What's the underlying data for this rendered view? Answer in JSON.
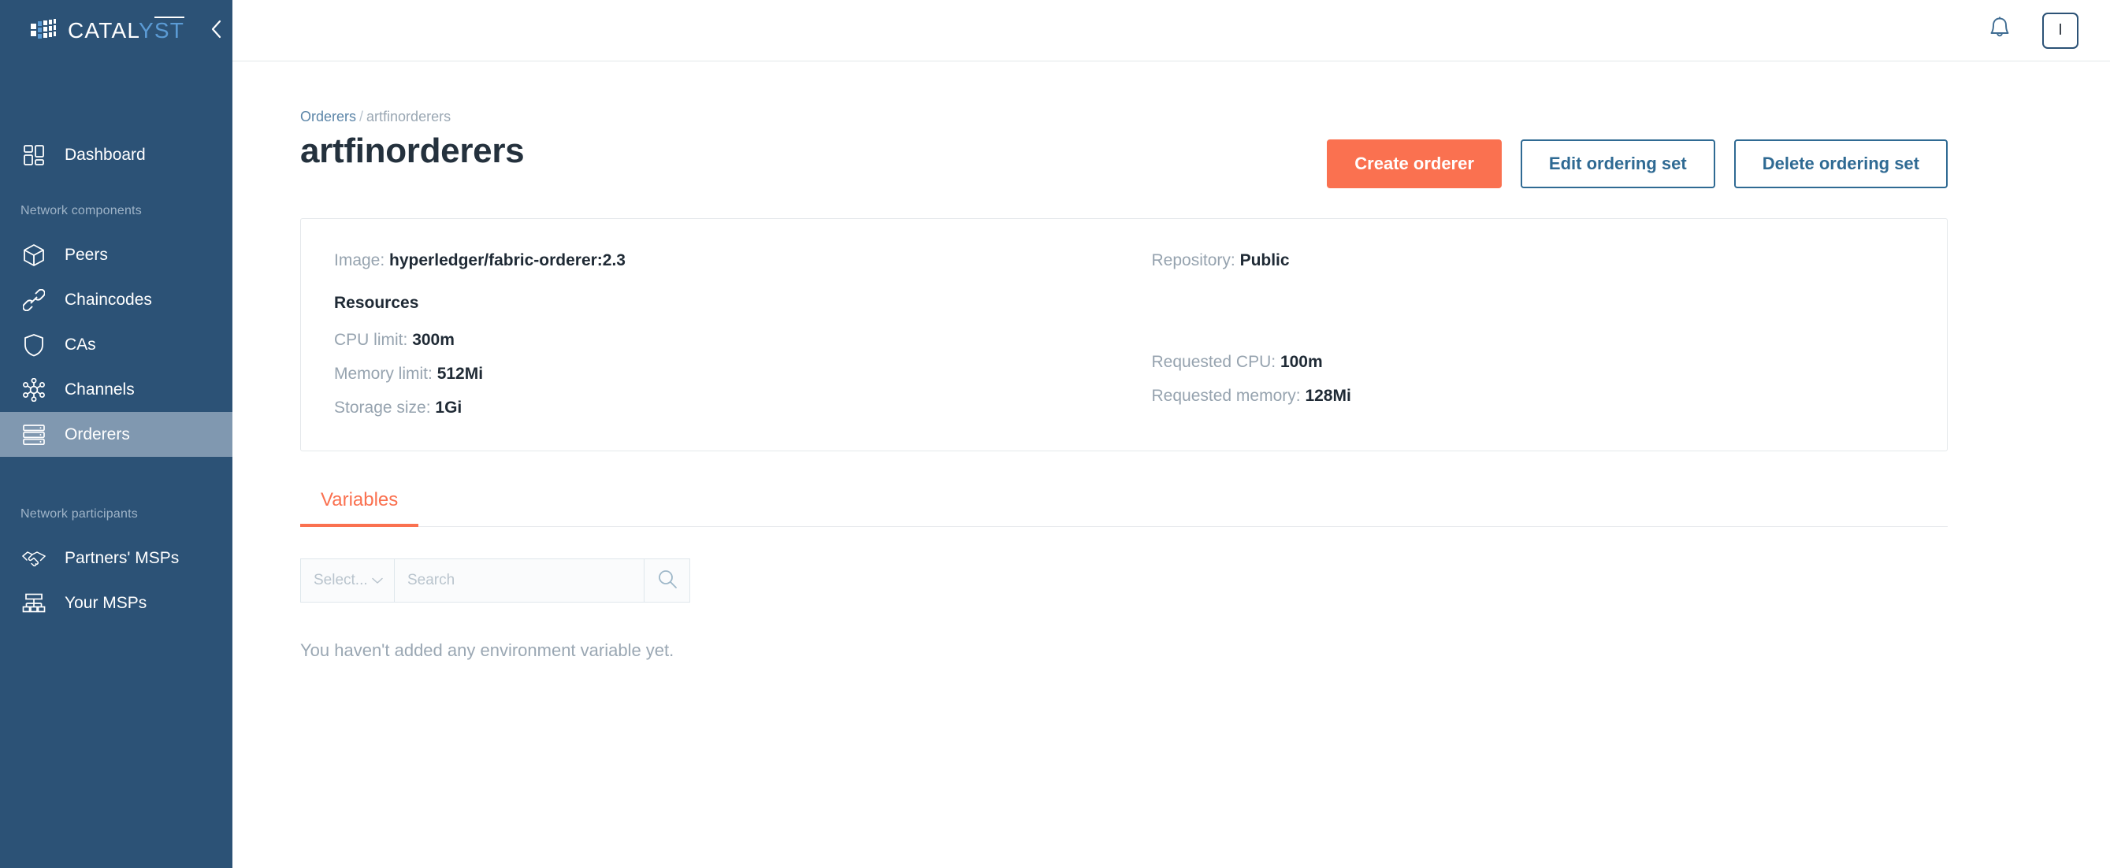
{
  "sidebar": {
    "brand": {
      "text_dark": "CATAL",
      "text_accent": "Y",
      "text_bar": "ST",
      "logo_icon": "cube-grid-icon"
    },
    "collapse_icon": "chevron-left-icon",
    "primary_items": [
      {
        "label": "Dashboard",
        "icon": "grid-dashboard-icon",
        "active": false
      }
    ],
    "section_components_label": "Network components",
    "component_items": [
      {
        "label": "Peers",
        "icon": "cube-icon",
        "active": false
      },
      {
        "label": "Chaincodes",
        "icon": "link-chain-icon",
        "active": false
      },
      {
        "label": "CAs",
        "icon": "shield-icon",
        "active": false
      },
      {
        "label": "Channels",
        "icon": "network-hub-icon",
        "active": false
      },
      {
        "label": "Orderers",
        "icon": "server-stack-icon",
        "active": true
      }
    ],
    "section_participants_label": "Network participants",
    "participant_items": [
      {
        "label": "Partners' MSPs",
        "icon": "handshake-icon",
        "active": false
      },
      {
        "label": "Your MSPs",
        "icon": "org-chart-icon",
        "active": false
      }
    ]
  },
  "topbar": {
    "bell_icon": "bell-icon",
    "avatar_label": "I"
  },
  "breadcrumb": {
    "parent": "Orderers",
    "separator": "/",
    "current": "artfinorderers"
  },
  "page": {
    "title": "artfinorderers"
  },
  "actions": {
    "create": "Create orderer",
    "edit": "Edit ordering set",
    "delete": "Delete ordering set"
  },
  "card": {
    "left": {
      "image_label": "Image:",
      "image_value": "hyperledger/fabric-orderer:2.3",
      "resources_heading": "Resources",
      "cpu_limit_label": "CPU limit:",
      "cpu_limit_value": "300m",
      "memory_limit_label": "Memory limit:",
      "memory_limit_value": "512Mi",
      "storage_size_label": "Storage size:",
      "storage_size_value": "1Gi"
    },
    "right": {
      "repository_label": "Repository:",
      "repository_value": "Public",
      "requested_cpu_label": "Requested CPU:",
      "requested_cpu_value": "100m",
      "requested_memory_label": "Requested memory:",
      "requested_memory_value": "128Mi"
    }
  },
  "tabs": [
    {
      "label": "Variables",
      "active": true
    }
  ],
  "filters": {
    "select_value": "Select...",
    "select_chevron_icon": "chevron-down-icon",
    "search_placeholder": "Search",
    "search_value": "",
    "search_icon": "search-icon"
  },
  "empty_state": {
    "message": "You haven't added any environment variable yet."
  },
  "colors": {
    "sidebar_bg": "#2c5276",
    "sidebar_active": "#8098b0",
    "accent_orange": "#fa7150",
    "link_blue": "#5b85a8",
    "outline_blue": "#2f6a93"
  }
}
